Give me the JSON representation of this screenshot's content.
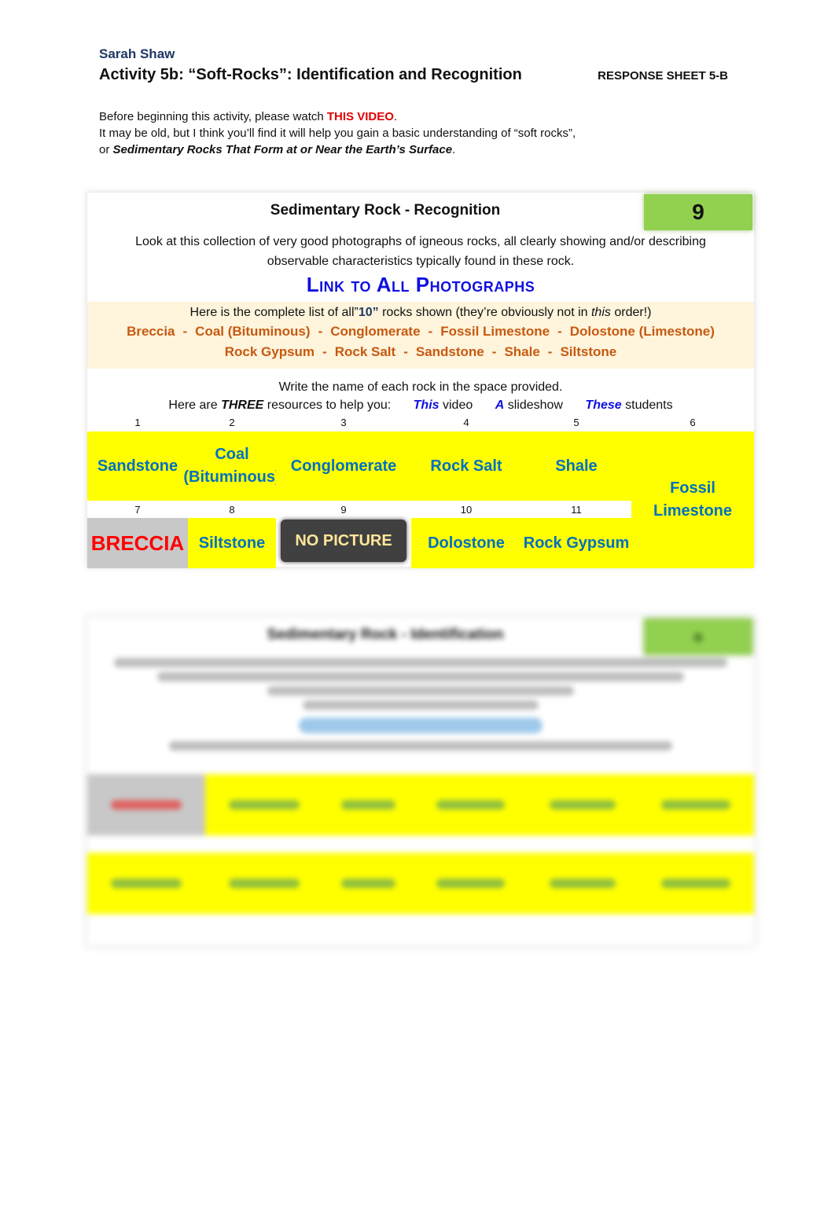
{
  "header": {
    "author": "Sarah Shaw",
    "title": "Activity 5b: “Soft-Rocks”: Identification and Recognition",
    "sheet_label": "RESPONSE SHEET 5-B"
  },
  "intro": {
    "line1_prefix": "Before beginning this activity, please watch ",
    "video_link": "THIS VIDEO",
    "line1_suffix": ".",
    "line2": "It may be old, but I think you’ll find it will help you gain a basic understanding of “soft rocks”,",
    "line3_prefix": "or ",
    "line3_emph": "Sedimentary Rocks That Form at or Near the Earth’s Surface",
    "line3_suffix": "."
  },
  "recognition": {
    "title": "Sedimentary Rock - Recognition",
    "score": "9",
    "description": "Look at this collection of very good photographs of igneous rocks, all clearly showing and/or describing observable characteristics typically found in these rock.",
    "photos_link": "Link to All Photographs",
    "list_intro_prefix": "Here is the complete list of all”",
    "list_count": "10”",
    "list_intro_mid": " rocks shown (they’re obviously not in ",
    "list_intro_emph": "this",
    "list_intro_suffix": " order!)",
    "rock_list_row1": [
      "Breccia",
      "Coal (Bituminous)",
      "Conglomerate",
      "Fossil Limestone",
      "Dolostone (Limestone)"
    ],
    "rock_list_row2": [
      "Rock Gypsum",
      "Rock Salt",
      "Sandstone",
      "Shale",
      "Siltstone"
    ],
    "separator": "-",
    "write_instruction": "Write the name of each rock in the space provided.",
    "resources_prefix": "Here are ",
    "resources_count": "THREE",
    "resources_suffix": " resources to help you:",
    "resources": [
      {
        "link": "This",
        "text": " video"
      },
      {
        "link": "A",
        "text": " slideshow"
      },
      {
        "link": "These",
        "text": " students"
      }
    ],
    "answers": [
      {
        "number": "1",
        "answer": "Sandstone"
      },
      {
        "number": "2",
        "answer": "Coal (Bituminous)"
      },
      {
        "number": "3",
        "answer": "Conglomerate"
      },
      {
        "number": "4",
        "answer": "Rock Salt"
      },
      {
        "number": "5",
        "answer": "Shale"
      },
      {
        "number": "6",
        "answer": "Fossil Limestone"
      },
      {
        "number": "7",
        "answer": "BRECCIA"
      },
      {
        "number": "8",
        "answer": "Siltstone"
      },
      {
        "number": "9",
        "answer": "NO PICTURE"
      },
      {
        "number": "10",
        "answer": "Dolostone"
      },
      {
        "number": "11",
        "answer": "Rock Gypsum"
      }
    ]
  },
  "identification": {
    "title": "Sedimentary Rock - Identification",
    "blurred": true
  }
}
